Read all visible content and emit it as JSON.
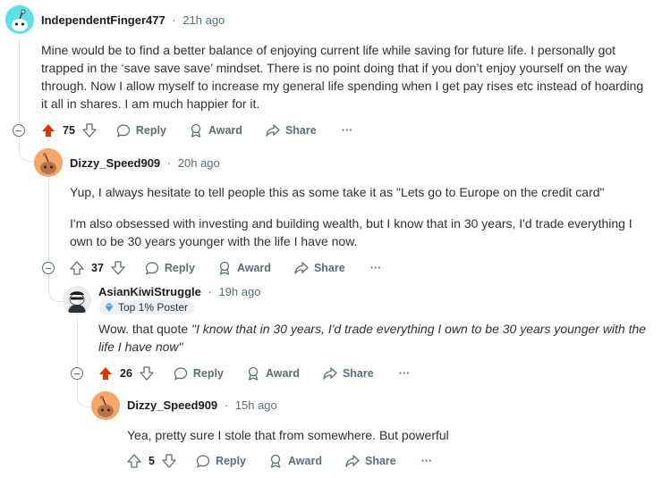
{
  "comments": [
    {
      "author": "IndependentFinger477",
      "time": "21h ago",
      "body": "Mine would be to find a better balance of enjoying current life while saving for future life. I personally got trapped in the ‘save save save’ mindset. There is no point doing that if you don’t enjoy yourself on the way through. Now I allow myself to increase my general life spending when I get pay rises etc instead of hoarding it all in shares.  I am much happier for it.",
      "votes": "75",
      "upvoted": true
    },
    {
      "author": "Dizzy_Speed909",
      "time": "20h ago",
      "body1": "Yup, I always hesitate to tell people this as some take it as \"Lets go to Europe on the credit card\"",
      "body2": "I'm also obsessed with investing and building wealth, but I know that in 30 years, I'd trade everything I own to be 30 years younger with the life I have now.",
      "votes": "37",
      "upvoted": false
    },
    {
      "author": "AsianKiwiStruggle",
      "time": "19h ago",
      "flair": "Top 1% Poster",
      "body_prefix": "Wow. that quote ",
      "body_quote": "\"I know that in 30 years, I'd trade everything I own to be 30 years younger with the life I have now\"",
      "votes": "26",
      "upvoted": true
    },
    {
      "author": "Dizzy_Speed909",
      "time": "15h ago",
      "body": "Yea, pretty sure I stole that from somewhere. But powerful",
      "votes": "5",
      "upvoted": false
    }
  ],
  "actions": {
    "reply": "Reply",
    "award": "Award",
    "share": "Share",
    "more": "···"
  },
  "meta_separator": "·",
  "colors": {
    "upvote_active": "#d93a00",
    "muted": "#576f76",
    "thread_line": "#e0e3e6",
    "avatar_teal": "#5ee0e8",
    "avatar_orange": "#f5a66a"
  }
}
